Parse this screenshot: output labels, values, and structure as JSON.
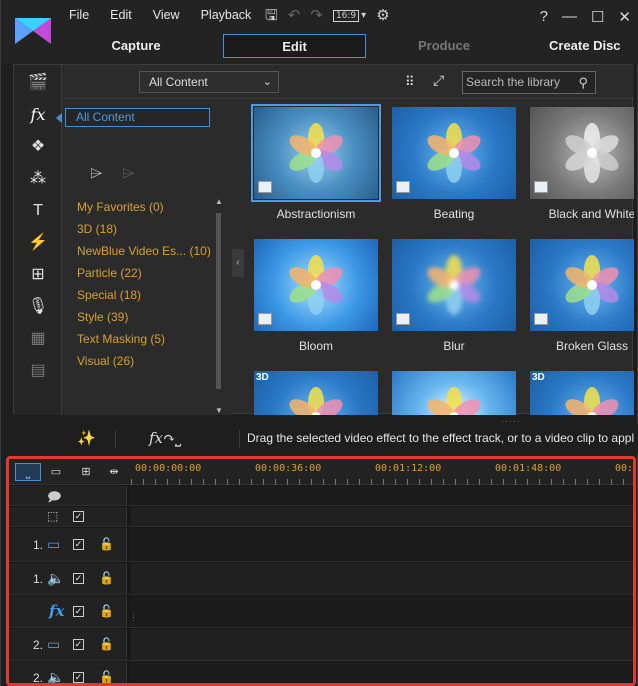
{
  "menu": [
    "File",
    "Edit",
    "View",
    "Playback"
  ],
  "toolbar": {
    "ratio": "16:9"
  },
  "window_buttons": [
    "?",
    "—",
    "☐",
    "✕"
  ],
  "modes": {
    "capture": "Capture",
    "edit": "Edit",
    "produce": "Produce",
    "create_disc": "Create Disc"
  },
  "library": {
    "dropdown": "All Content",
    "search_placeholder": "Search the library",
    "category_header": "All Content",
    "categories": [
      {
        "label": "My Favorites  (0)"
      },
      {
        "label": "3D  (18)"
      },
      {
        "label": "NewBlue Video Es...  (10)"
      },
      {
        "label": "Particle  (22)"
      },
      {
        "label": "Special  (18)"
      },
      {
        "label": "Style  (39)"
      },
      {
        "label": "Text Masking  (5)"
      },
      {
        "label": "Visual  (26)"
      }
    ],
    "effects": [
      {
        "name": "Abstractionism"
      },
      {
        "name": "Beating"
      },
      {
        "name": "Black and White"
      },
      {
        "name": "Bloom"
      },
      {
        "name": "Blur"
      },
      {
        "name": "Broken Glass"
      }
    ],
    "badge_3d": "3D"
  },
  "hint": "Drag the selected video effect to the effect track, or to a video clip to appl",
  "timeline": {
    "ruler": [
      "00:00:00:00",
      "00:00:36:00",
      "00:01:12:00",
      "00:01:48:00",
      "00:0"
    ],
    "tracks": [
      {
        "num": "1.",
        "kind": "video"
      },
      {
        "num": "1.",
        "kind": "audio"
      },
      {
        "num": "",
        "kind": "fx"
      },
      {
        "num": "2.",
        "kind": "video"
      },
      {
        "num": "2.",
        "kind": "audio"
      }
    ]
  },
  "colors": {
    "accent": "#4a8fd4",
    "category": "#d8a032",
    "highlight_border": "#e03a2f"
  }
}
